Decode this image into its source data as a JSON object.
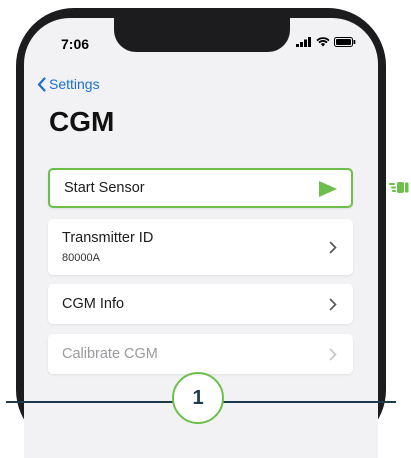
{
  "status_bar": {
    "time": "7:06"
  },
  "nav": {
    "back_label": "Settings"
  },
  "page": {
    "title": "CGM"
  },
  "list": {
    "start_sensor": {
      "label": "Start Sensor"
    },
    "transmitter": {
      "label": "Transmitter ID",
      "value": "80000A"
    },
    "cgm_info": {
      "label": "CGM Info"
    },
    "calibrate": {
      "label": "Calibrate CGM"
    }
  },
  "step": {
    "number": "1"
  },
  "colors": {
    "accent": "#6cbf4a",
    "link": "#1a6fd6",
    "line": "#1e3a4d"
  }
}
